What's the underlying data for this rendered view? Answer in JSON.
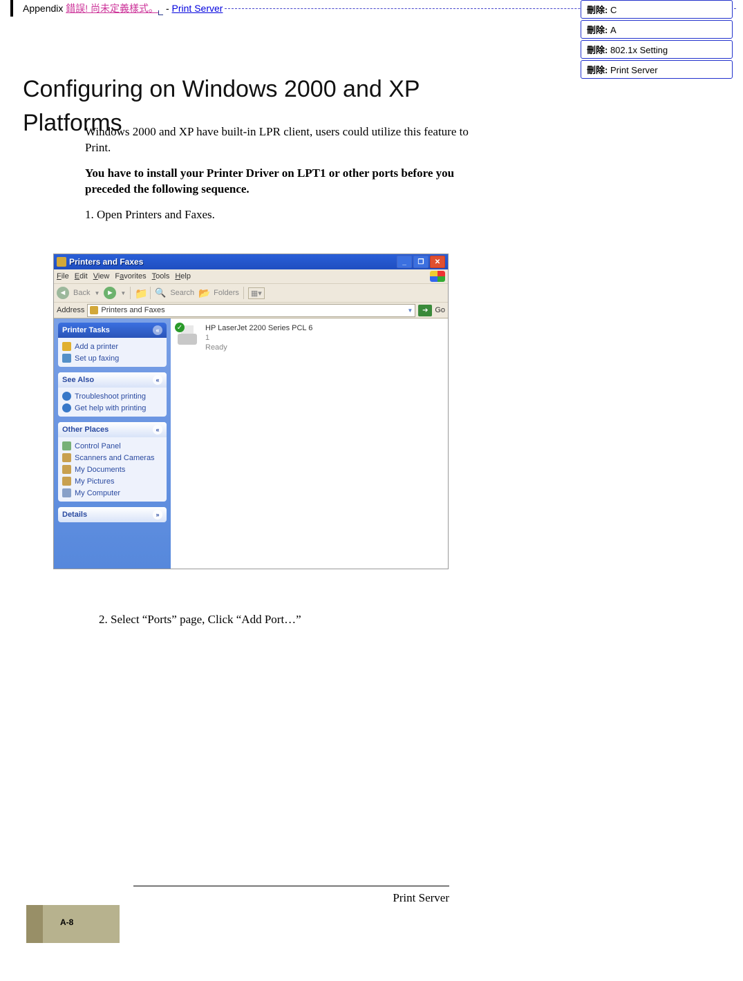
{
  "header": {
    "prefix": "Appendix ",
    "error_text": "錯誤! 尚未定義樣式。",
    "separator": " - ",
    "link_text": "Print Server"
  },
  "balloons": [
    {
      "label": "刪除:",
      "value": " C"
    },
    {
      "label": "刪除:",
      "value": " A"
    },
    {
      "label": "刪除:",
      "value": " 802.1x Setting"
    },
    {
      "label": "刪除:",
      "value": " Print Server"
    }
  ],
  "title": "Configuring on Windows 2000 and XP Platforms",
  "body": {
    "p1": "Windows 2000 and XP have built-in LPR client, users could utilize this feature to Print.",
    "p2": "You have to install your Printer Driver on LPT1 or other ports before you preceded the following sequence.",
    "step1": "1.   Open Printers and Faxes.",
    "step2": "2.        Select “Ports” page, Click “Add Port…”"
  },
  "screenshot": {
    "title": "Printers and Faxes",
    "menu": {
      "file": "File",
      "edit": "Edit",
      "view": "View",
      "favorites": "Favorites",
      "tools": "Tools",
      "help": "Help"
    },
    "toolbar": {
      "back": "Back",
      "search": "Search",
      "folders": "Folders"
    },
    "address": {
      "label": "Address",
      "value": "Printers and Faxes",
      "go": "Go"
    },
    "tasks": {
      "printer_tasks": {
        "title": "Printer Tasks",
        "add": "Add a printer",
        "fax": "Set up faxing"
      },
      "see_also": {
        "title": "See Also",
        "trouble": "Troubleshoot printing",
        "help": "Get help with printing"
      },
      "other_places": {
        "title": "Other Places",
        "cp": "Control Panel",
        "sc": "Scanners and Cameras",
        "docs": "My Documents",
        "pics": "My Pictures",
        "comp": "My Computer"
      },
      "details": {
        "title": "Details"
      }
    },
    "printer": {
      "name": "HP LaserJet 2200 Series PCL 6",
      "docs": "1",
      "status": "Ready"
    }
  },
  "footer": {
    "text": "Print Server",
    "pagenum": "A-8"
  }
}
